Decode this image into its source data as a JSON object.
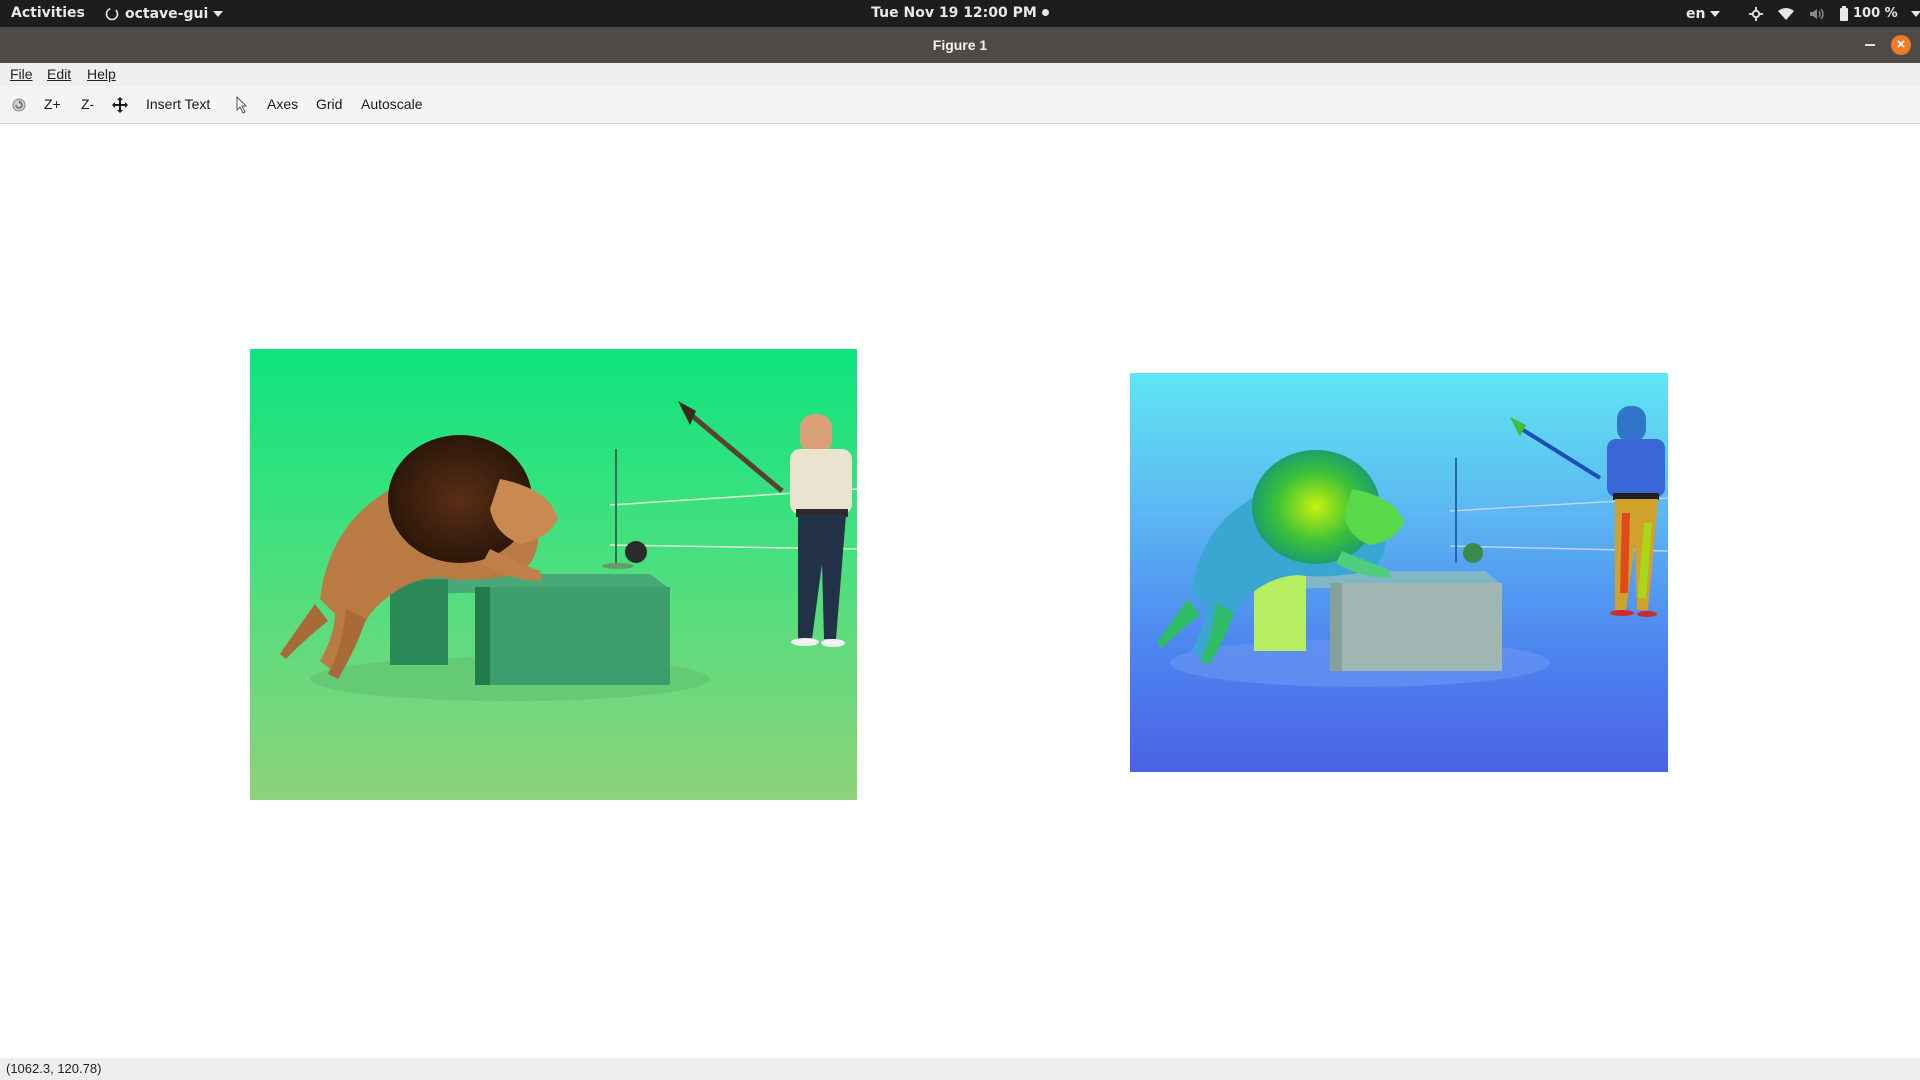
{
  "topbar": {
    "activities": "Activities",
    "app_name": "octave-gui",
    "clock": "Tue Nov 19  12:00 PM",
    "language": "en",
    "battery": "100 %"
  },
  "window": {
    "title": "Figure 1"
  },
  "menubar": {
    "items": [
      "File",
      "Edit",
      "Help"
    ]
  },
  "toolbar": {
    "zoom_in": "Z+",
    "zoom_out": "Z-",
    "insert_text": "Insert Text",
    "axes": "Axes",
    "grid": "Grid",
    "autoscale": "Autoscale"
  },
  "figure": {
    "subplots": [
      {
        "description_icon": "image-original-green"
      },
      {
        "description_icon": "image-hsv-false-color"
      }
    ]
  },
  "status": {
    "coordinates": "(1062.3, 120.78)"
  },
  "colors": {
    "topbar": "#1d1d1d",
    "titlebar": "#4e4a45",
    "close_button": "#ee7b28",
    "greenscreen": "#3ee07f",
    "false_color_bg": "#4a7cf0"
  }
}
